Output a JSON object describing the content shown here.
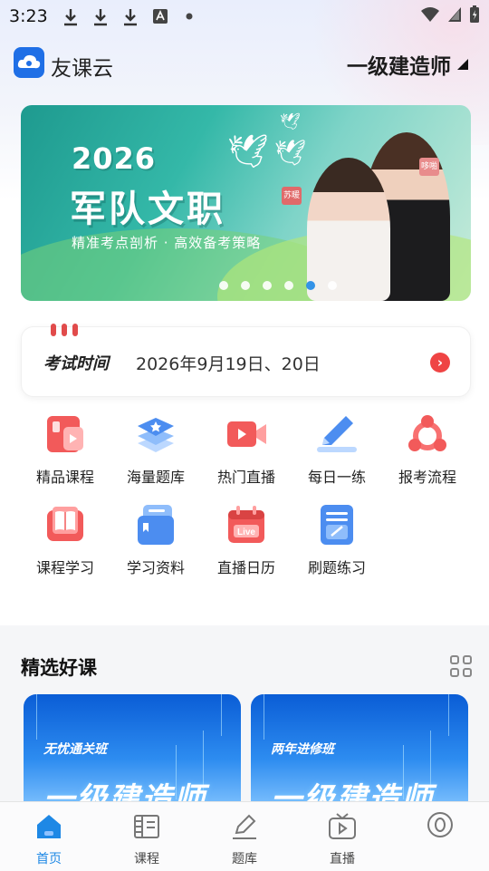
{
  "status_bar": {
    "time": "3:23"
  },
  "header": {
    "app_name": "友课云",
    "exam_selector": "一级建造师"
  },
  "banner": {
    "year": "2026",
    "title": "军队文职",
    "subtitle": "精准考点剖析 · 高效备考策略",
    "name_tags": [
      "苏暖",
      "哆啪"
    ],
    "slide_count": 6,
    "active_slide": 4
  },
  "exam_time": {
    "label": "考试时间",
    "date": "2026年9月19日、20日"
  },
  "quick_menu": [
    {
      "label": "精品课程",
      "icon": "video-card-icon"
    },
    {
      "label": "海量题库",
      "icon": "layer-stack-icon"
    },
    {
      "label": "热门直播",
      "icon": "live-camera-icon"
    },
    {
      "label": "每日一练",
      "icon": "pencil-icon"
    },
    {
      "label": "报考流程",
      "icon": "flow-circle-icon"
    },
    {
      "label": "课程学习",
      "icon": "book-icon"
    },
    {
      "label": "学习资料",
      "icon": "documents-icon"
    },
    {
      "label": "直播日历",
      "icon": "calendar-live-icon"
    },
    {
      "label": "刷题练习",
      "icon": "notepad-icon"
    }
  ],
  "featured": {
    "title": "精选好课",
    "courses": [
      {
        "badge": "无忧通关班",
        "title": "一级建造师"
      },
      {
        "badge": "两年进修班",
        "title": "一级建造师"
      }
    ]
  },
  "bottom_nav": [
    {
      "label": "首页",
      "icon": "home-icon",
      "active": true
    },
    {
      "label": "课程",
      "icon": "course-icon",
      "active": false
    },
    {
      "label": "题库",
      "icon": "question-bank-icon",
      "active": false
    },
    {
      "label": "直播",
      "icon": "tv-icon",
      "active": false
    },
    {
      "label": "",
      "icon": "profile-icon",
      "active": false
    }
  ],
  "colors": {
    "primary": "#1e88e5",
    "accent_red": "#ef4444"
  }
}
